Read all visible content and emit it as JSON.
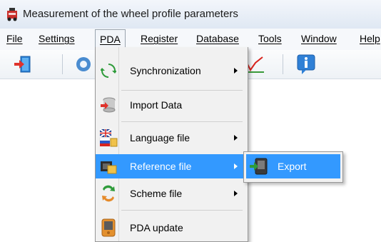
{
  "window": {
    "title": "Measurement of the wheel profile parameters"
  },
  "menubar": {
    "items": [
      "File",
      "Settings",
      "PDA",
      "Register",
      "Database",
      "Tools",
      "Window",
      "Help"
    ],
    "active": "PDA"
  },
  "pda_menu": {
    "items": [
      {
        "label": "Synchronization",
        "submenu": true,
        "icon": "sync-icon"
      },
      {
        "label": "Import Data",
        "submenu": false,
        "icon": "database-import-icon"
      },
      {
        "label": "Language file",
        "submenu": true,
        "icon": "language-flags-icon"
      },
      {
        "label": "Reference file",
        "submenu": true,
        "icon": "reference-file-icon",
        "highlighted": true
      },
      {
        "label": "Scheme file",
        "submenu": true,
        "icon": "scheme-file-icon"
      },
      {
        "label": "PDA update",
        "submenu": false,
        "icon": "pda-update-icon"
      }
    ]
  },
  "submenu": {
    "items": [
      {
        "label": "Export",
        "icon": "export-icon"
      }
    ]
  },
  "colors": {
    "highlight": "#3399ff",
    "menu_bg": "#f1f1f1"
  }
}
